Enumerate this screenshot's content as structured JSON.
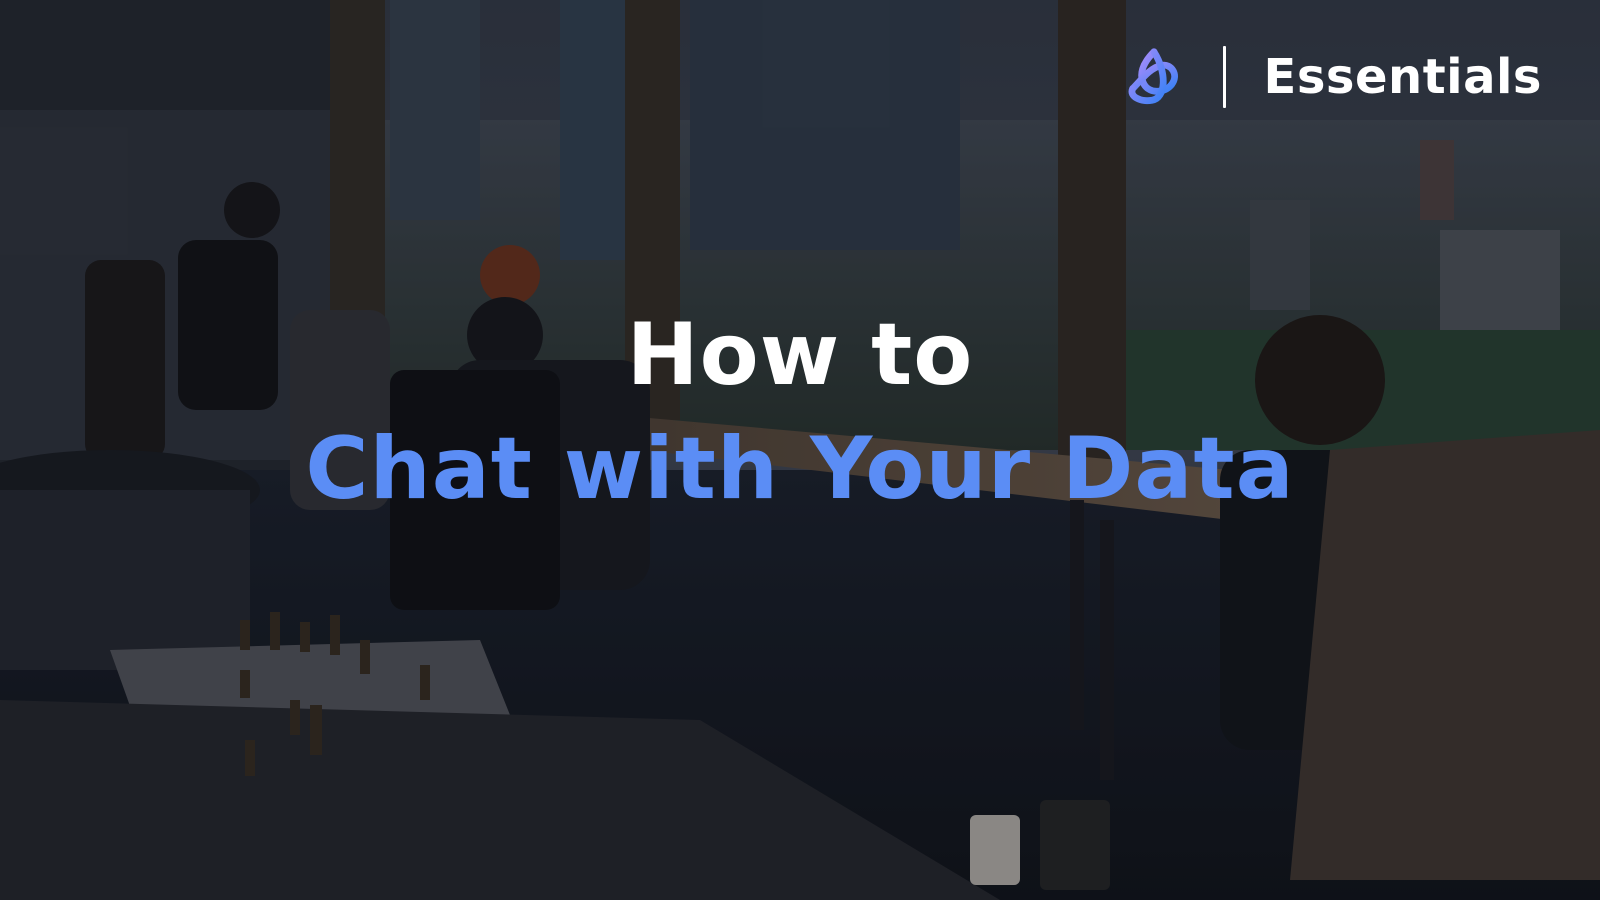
{
  "brand": {
    "logo_icon": "trefoil-knot-logo-icon",
    "name": "Essentials"
  },
  "headline": {
    "line1": "How to",
    "line2": "Chat with Your Data"
  },
  "colors": {
    "accent": "#5b8df5",
    "title_text": "#ffffff",
    "logo_gradient_start": "#a78bfa",
    "logo_gradient_end": "#3b82f6"
  },
  "background": {
    "image_subject": "office-with-city-view-photo"
  }
}
